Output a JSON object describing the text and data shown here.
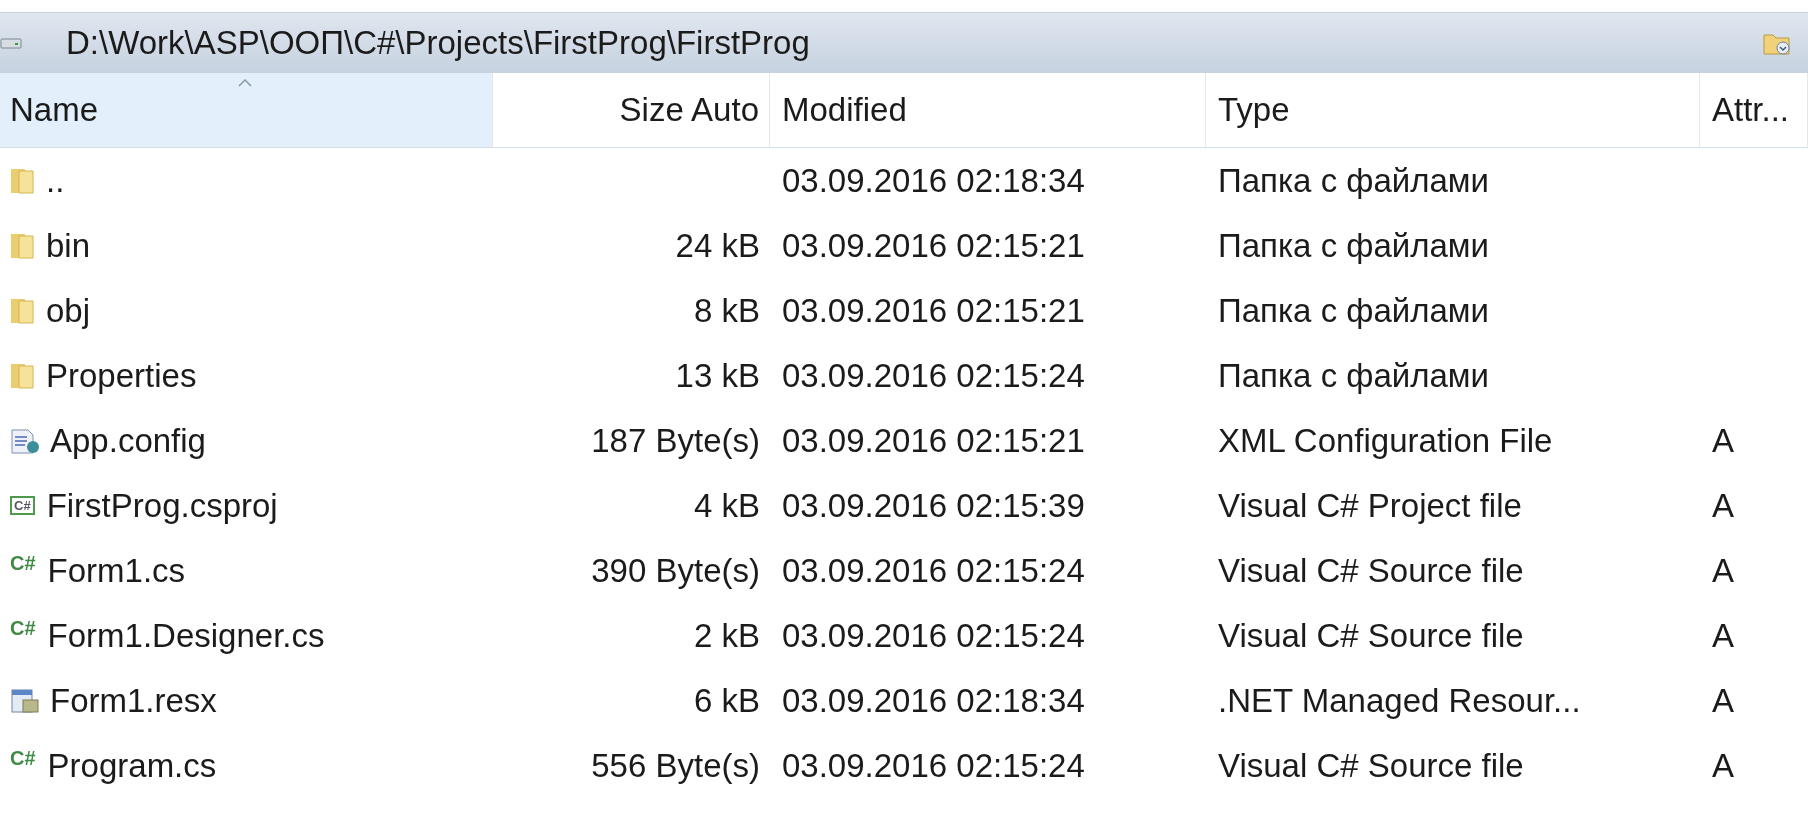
{
  "path_bar": {
    "path": "D:\\Work\\ASP\\OOП\\C#\\Projects\\FirstProg\\FirstProg"
  },
  "columns": [
    {
      "label": "Name",
      "sorted": true
    },
    {
      "label": "Size Auto",
      "sorted": false
    },
    {
      "label": "Modified",
      "sorted": false
    },
    {
      "label": "Type",
      "sorted": false
    },
    {
      "label": "Attr...",
      "sorted": false
    }
  ],
  "rows": [
    {
      "kind": "folder",
      "name": "..",
      "size": "",
      "modified": "03.09.2016 02:18:34",
      "type": "Папка с файлами",
      "attr": ""
    },
    {
      "kind": "folder",
      "name": "bin",
      "size": "24 kB",
      "modified": "03.09.2016 02:15:21",
      "type": "Папка с файлами",
      "attr": ""
    },
    {
      "kind": "folder",
      "name": "obj",
      "size": "8 kB",
      "modified": "03.09.2016 02:15:21",
      "type": "Папка с файлами",
      "attr": ""
    },
    {
      "kind": "folder",
      "name": "Properties",
      "size": "13 kB",
      "modified": "03.09.2016 02:15:24",
      "type": "Папка с файлами",
      "attr": ""
    },
    {
      "kind": "config",
      "name": "App.config",
      "size": "187 Byte(s)",
      "modified": "03.09.2016 02:15:21",
      "type": "XML Configuration File",
      "attr": "A"
    },
    {
      "kind": "csproj",
      "icon_label": "C#",
      "name": "FirstProg.csproj",
      "size": "4 kB",
      "modified": "03.09.2016 02:15:39",
      "type": "Visual C# Project file",
      "attr": "A"
    },
    {
      "kind": "cs",
      "icon_label": "C#",
      "name": "Form1.cs",
      "size": "390 Byte(s)",
      "modified": "03.09.2016 02:15:24",
      "type": "Visual C# Source file",
      "attr": "A"
    },
    {
      "kind": "cs",
      "icon_label": "C#",
      "name": "Form1.Designer.cs",
      "size": "2 kB",
      "modified": "03.09.2016 02:15:24",
      "type": "Visual C# Source file",
      "attr": "A"
    },
    {
      "kind": "resx",
      "name": "Form1.resx",
      "size": "6 kB",
      "modified": "03.09.2016 02:18:34",
      "type": ".NET Managed Resour...",
      "attr": "A"
    },
    {
      "kind": "cs",
      "icon_label": "C#",
      "name": "Program.cs",
      "size": "556 Byte(s)",
      "modified": "03.09.2016 02:15:24",
      "type": "Visual C# Source file",
      "attr": "A"
    }
  ]
}
